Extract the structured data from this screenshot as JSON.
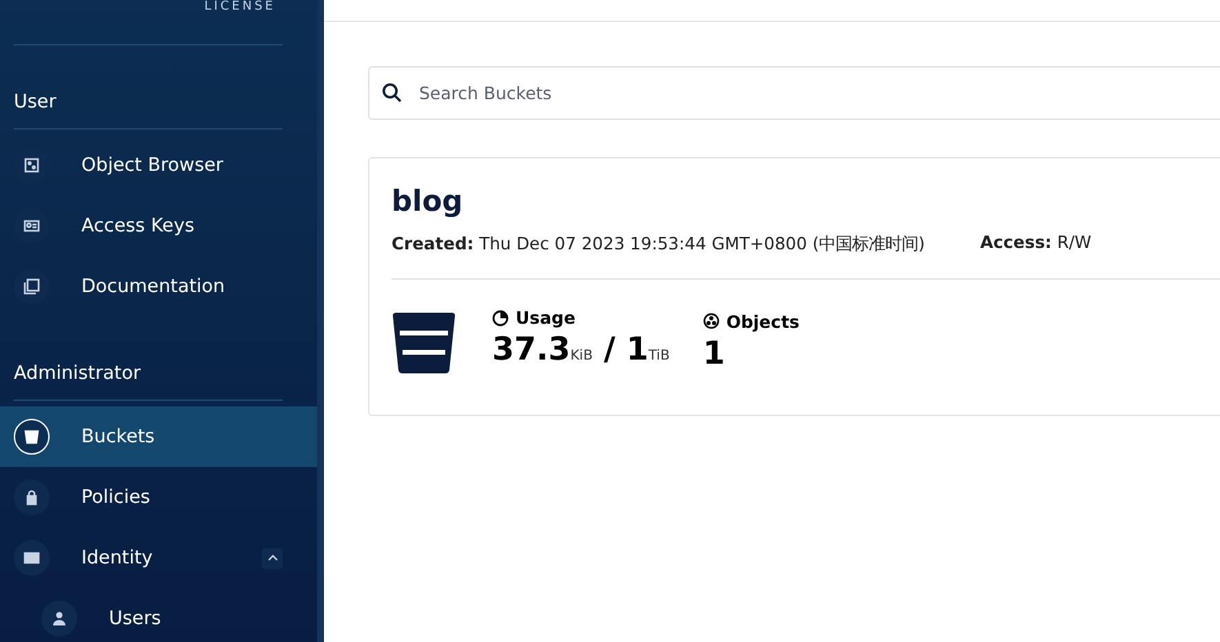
{
  "logo": {
    "caption": "LICENSE"
  },
  "sidebar": {
    "sections": [
      {
        "title": "User",
        "items": [
          {
            "label": "Object Browser",
            "selected": false
          },
          {
            "label": "Access Keys",
            "selected": false
          },
          {
            "label": "Documentation",
            "selected": false
          }
        ]
      },
      {
        "title": "Administrator",
        "items": [
          {
            "label": "Buckets",
            "selected": true
          },
          {
            "label": "Policies",
            "selected": false
          },
          {
            "label": "Identity",
            "selected": false,
            "expanded": true,
            "children": [
              {
                "label": "Users",
                "selected": false
              }
            ]
          }
        ]
      }
    ]
  },
  "search": {
    "placeholder": "Search Buckets"
  },
  "buckets": [
    {
      "name": "blog",
      "created_label": "Created:",
      "created": "Thu Dec 07 2023 19:53:44 GMT+0800 (中国标准时间)",
      "access_label": "Access:",
      "access": "R/W",
      "usage_label": "Usage",
      "usage_value": "37.3",
      "usage_unit": "KiB",
      "separator": "/",
      "quota_value": "1",
      "quota_unit": "TiB",
      "objects_label": "Objects",
      "objects": "1"
    }
  ]
}
